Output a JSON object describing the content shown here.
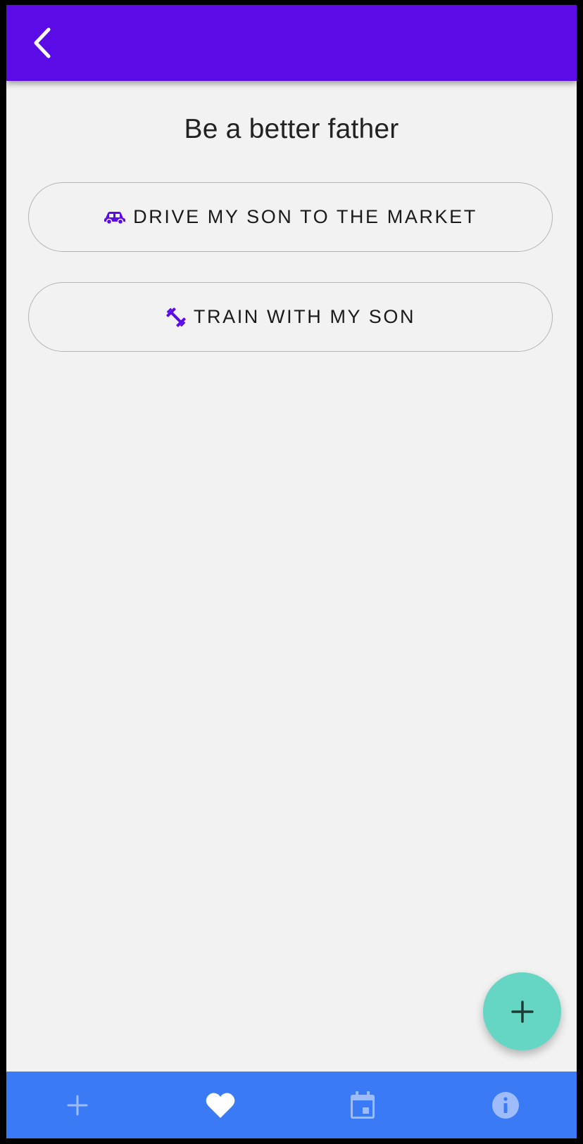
{
  "header": {
    "back_icon": "chevron-left-icon",
    "color": "#5a0be6"
  },
  "page": {
    "title": "Be a better father"
  },
  "actions": [
    {
      "label": "DRIVE MY SON TO THE MARKET",
      "icon": "car-icon"
    },
    {
      "label": "TRAIN WITH MY SON",
      "icon": "dumbbell-icon"
    }
  ],
  "fab": {
    "icon": "plus-icon",
    "color": "#66d6c4"
  },
  "bottom_nav": {
    "color": "#3b7af5",
    "items": [
      {
        "icon": "plus-icon",
        "active": false
      },
      {
        "icon": "heart-icon",
        "active": true
      },
      {
        "icon": "calendar-icon",
        "active": false
      },
      {
        "icon": "info-icon",
        "active": false
      }
    ]
  },
  "colors": {
    "accent": "#5a0be6",
    "background": "#f2f2f2"
  }
}
